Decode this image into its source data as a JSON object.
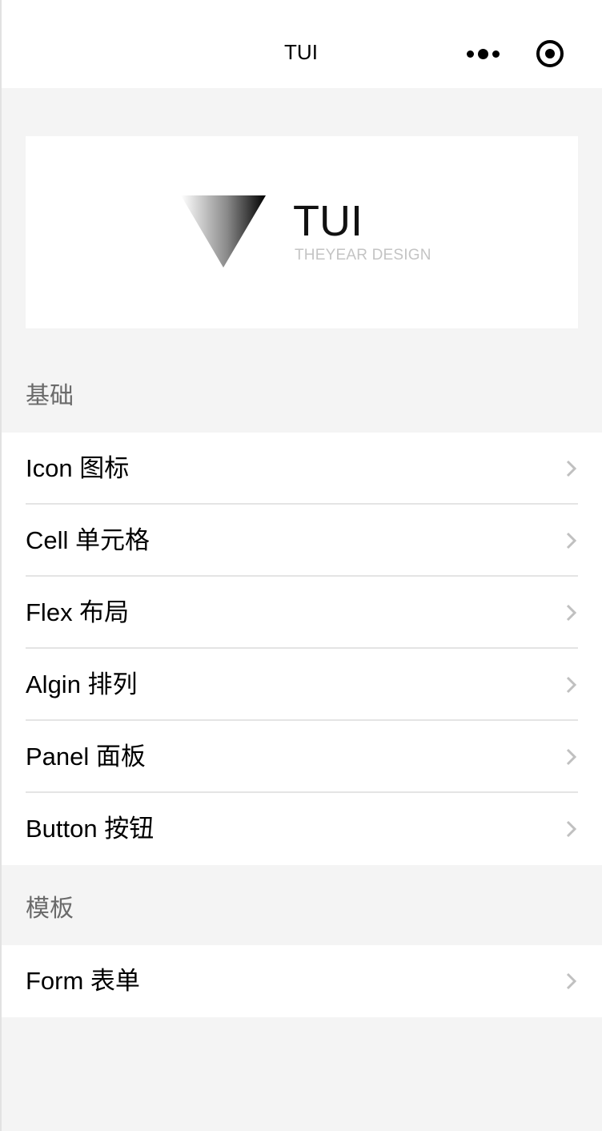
{
  "navbar": {
    "title": "TUI"
  },
  "banner": {
    "logo_name": "TUI",
    "logo_subtitle": "THEYEAR DESIGN"
  },
  "sections": {
    "basic": {
      "title": "基础",
      "items": [
        {
          "label": "Icon 图标"
        },
        {
          "label": "Cell 单元格"
        },
        {
          "label": "Flex 布局"
        },
        {
          "label": "Algin 排列"
        },
        {
          "label": "Panel 面板"
        },
        {
          "label": "Button 按钮"
        }
      ]
    },
    "templates": {
      "title": "模板",
      "items": [
        {
          "label": "Form 表单"
        }
      ]
    }
  },
  "icons": {
    "more": "more-dots-icon",
    "target": "target-icon",
    "chevron": "chevron-right-icon",
    "logo": "triangle-logo-icon"
  },
  "colors": {
    "page_background": "#f4f4f4",
    "section_title": "#6a6a6a",
    "chevron": "#c0c0c0",
    "subtitle": "#c4c4c4"
  }
}
